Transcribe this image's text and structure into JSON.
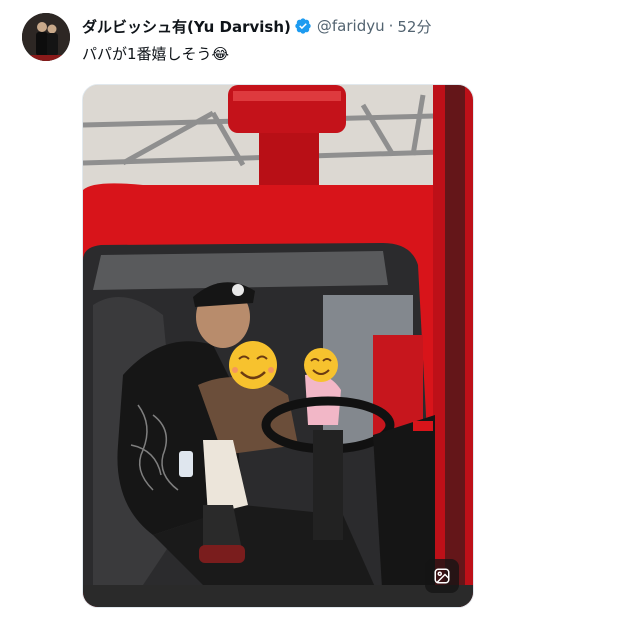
{
  "tweet": {
    "author_name": "ダルビッシュ有(Yu Darvish)",
    "handle": "@faridyu",
    "separator": "·",
    "time": "52分",
    "text": "パパが1番嬉しそう😂"
  },
  "colors": {
    "name": "#0f1419",
    "secondary_text": "#536471",
    "verified_badge": "#1d9bf0",
    "firetruck_red": "#d8141a"
  },
  "icons": {
    "verified": "verified-badge-icon",
    "media_action": "image-edit-icon"
  }
}
